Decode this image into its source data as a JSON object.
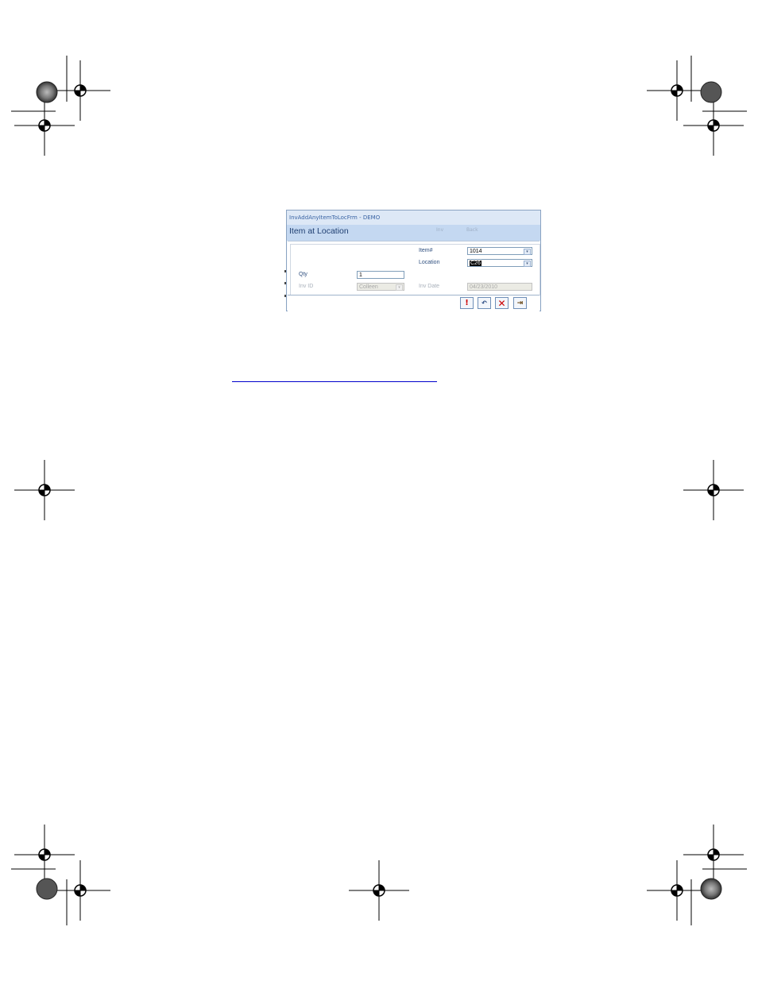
{
  "window": {
    "title": "InvAddAnyItemToLocFrm - DEMO",
    "form_title": "Item at Location",
    "header_hints": [
      "Inv",
      "Back"
    ]
  },
  "form": {
    "item": {
      "label": "Item#",
      "value": "1014"
    },
    "location": {
      "label": "Location",
      "value": "C26"
    },
    "qty": {
      "label": "Qty",
      "value": "1"
    },
    "inv_id": {
      "label": "Inv ID",
      "value": "Colleen"
    },
    "inv_date": {
      "label": "Inv Date",
      "value": "04/23/2010"
    }
  },
  "footer": {
    "buttons": [
      {
        "name": "save",
        "glyph": "!"
      },
      {
        "name": "undo",
        "glyph": "↶"
      },
      {
        "name": "delete",
        "glyph": "✕"
      },
      {
        "name": "exit",
        "glyph": "⇥"
      }
    ]
  }
}
